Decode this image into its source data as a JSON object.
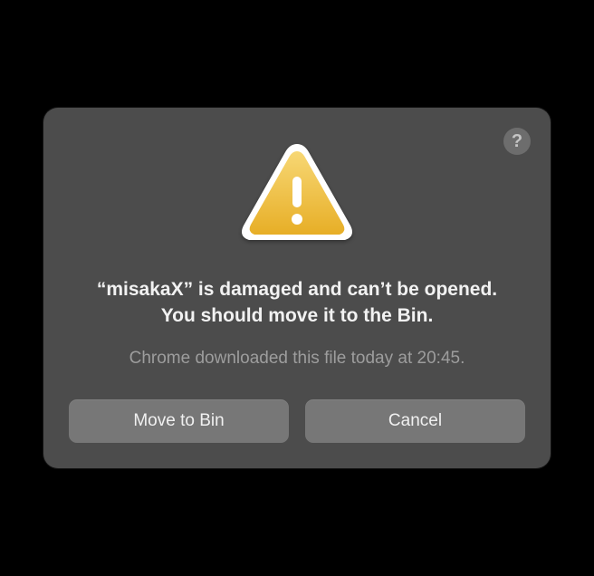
{
  "dialog": {
    "title": "“misakaX” is damaged and can’t be opened. You should move it to the Bin.",
    "subtitle": "Chrome downloaded this file today at 20:45.",
    "buttons": {
      "primary": "Move to Bin",
      "secondary": "Cancel"
    },
    "help_label": "?"
  },
  "icons": {
    "warning": "warning-triangle",
    "help": "help-circle"
  },
  "colors": {
    "dialog_bg": "#4c4c4c",
    "button_bg": "#777777",
    "text_primary": "#f2f2f2",
    "text_secondary": "#9d9d9d",
    "warning_yellow": "#f0c23c"
  }
}
